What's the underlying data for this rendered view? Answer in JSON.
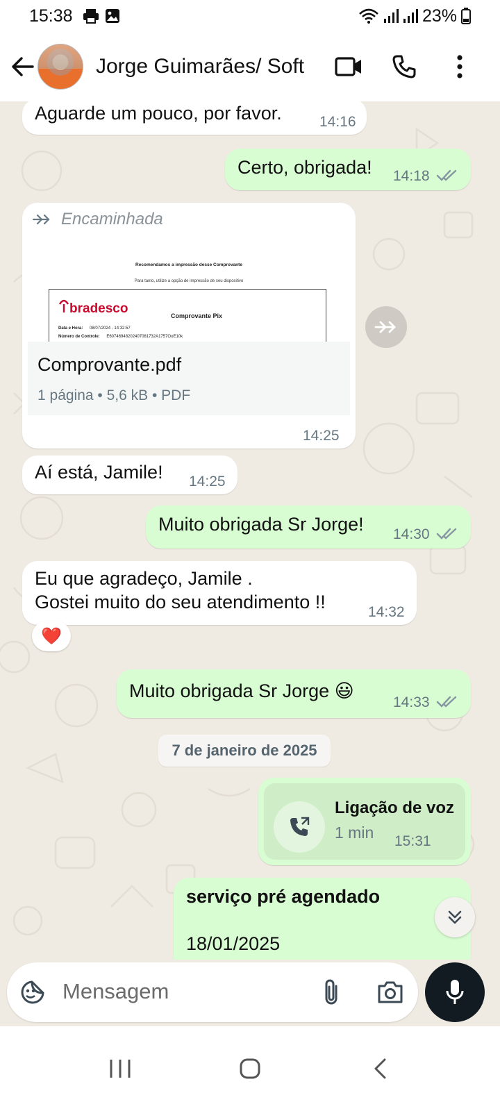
{
  "status_bar": {
    "time": "15:38",
    "battery": "23%"
  },
  "header": {
    "contact_name": "Jorge Guimarães/ Soft",
    "icons": [
      "back-arrow-icon",
      "video-call-icon",
      "phone-icon",
      "more-vert-icon"
    ]
  },
  "messages": [
    {
      "dir": "in",
      "text": "Aguarde um pouco, por favor.",
      "time": "14:16"
    },
    {
      "dir": "out",
      "text": "Certo, obrigada!",
      "time": "14:18",
      "status": "read"
    },
    {
      "dir": "in",
      "type": "document",
      "forwarded_label": "Encaminhada",
      "preview": {
        "line1": "Recomendamos a impressão desse Comprovante",
        "line2": "Para tanto, utilize a opção de impressão de seu dispositivo",
        "brand": "bradesco",
        "doc_title": "Comprovante Pix",
        "row1_label": "Data e Hora:",
        "row1_value": "08/07/2024 - 14:32:57",
        "row2_label": "Número de Controle:",
        "row2_value": "E60746948202407081732A1757OoE10k"
      },
      "file_name": "Comprovante.pdf",
      "file_meta": "1 página • 5,6 kB • PDF",
      "time": "14:25"
    },
    {
      "dir": "in",
      "text": "Aí está, Jamile!",
      "time": "14:25"
    },
    {
      "dir": "out",
      "text": "Muito obrigada Sr Jorge!",
      "time": "14:30",
      "status": "read"
    },
    {
      "dir": "in",
      "text_line1": "Eu que agradeço, Jamile .",
      "text_line2": "Gostei muito do seu atendimento !!",
      "time": "14:32",
      "reaction": "❤️"
    },
    {
      "dir": "out",
      "text": "Muito obrigada Sr Jorge 😃",
      "time": "14:33",
      "status": "read"
    },
    {
      "type": "date",
      "text": "7 de janeiro de 2025"
    },
    {
      "dir": "out",
      "type": "call",
      "title": "Ligação de voz",
      "duration": "1 min",
      "time": "15:31"
    },
    {
      "dir": "out",
      "title": "serviço pré agendado",
      "text": "18/01/2025"
    }
  ],
  "composer": {
    "placeholder": "Mensagem",
    "icons": [
      "sticker-icon",
      "attach-icon",
      "camera-icon",
      "mic-icon"
    ]
  },
  "colors": {
    "chat_bg": "#efeae2",
    "incoming": "#ffffff",
    "outgoing": "#d9fdd3",
    "tick": "#8696a0"
  }
}
